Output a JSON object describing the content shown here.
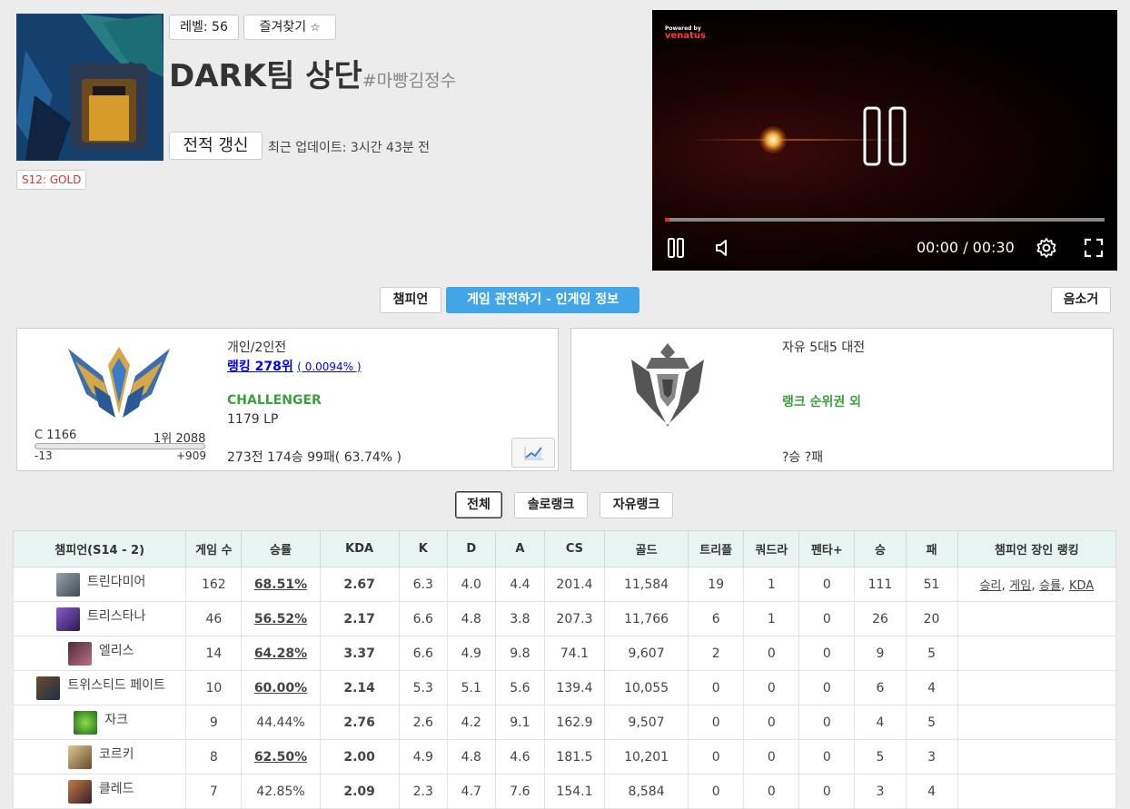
{
  "profile": {
    "level_label": "레벨: 56",
    "favorite_label": "즐겨찾기",
    "favorite_star": "☆",
    "name": "DARK팀 상단",
    "tag": "#마빵김정수",
    "refresh_label": "전적 갱신",
    "last_update": "최근 업데이트: 3시간 43분 전",
    "season_badge": "S12: GOLD"
  },
  "video": {
    "ad_powered": "Powered by",
    "ad_brand": "venatus",
    "time": "00:00 / 00:30",
    "progress": 0.01
  },
  "tabs": {
    "champion": "챔피언",
    "spectate": "게임 관전하기 - 인게임 정보",
    "remove": "음소거"
  },
  "solo_rank": {
    "queue": "개인/2인전",
    "ranking": "랭킹 278위",
    "ranking_pct": "( 0.0094% )",
    "tier": "CHALLENGER",
    "lp": "1179 LP",
    "cutoff_left": "C 1166",
    "cutoff_right": "1위 2088",
    "diff_left": "-13",
    "diff_right": "+909",
    "lp_progress": 0.01,
    "record": "273전 174승 99패( 63.74% )"
  },
  "flex_rank": {
    "queue": "자유 5대5 대전",
    "status": "랭크 순위권 외",
    "record": "?승 ?패"
  },
  "filters": {
    "all": "전체",
    "solo": "솔로랭크",
    "flex": "자유랭크"
  },
  "table": {
    "headers": [
      "챔피언(S14 - 2)",
      "게임 수",
      "승률",
      "KDA",
      "K",
      "D",
      "A",
      "CS",
      "골드",
      "트리플",
      "쿼드라",
      "펜타+",
      "승",
      "패",
      "챔피언 장인 랭킹"
    ],
    "mastery_links": [
      "승리",
      "게임",
      "승률",
      "KDA"
    ],
    "rows": [
      {
        "champion": "트린다미어",
        "games": "162",
        "winrate": "68.51%",
        "kda": "2.67",
        "k": "6.3",
        "d": "4.0",
        "a": "4.4",
        "cs": "201.4",
        "gold": "11,584",
        "triple": "19",
        "quadra": "1",
        "penta": "0",
        "wins": "111",
        "losses": "51"
      },
      {
        "champion": "트리스타나",
        "games": "46",
        "winrate": "56.52%",
        "kda": "2.17",
        "k": "6.6",
        "d": "4.8",
        "a": "3.8",
        "cs": "207.3",
        "gold": "11,766",
        "triple": "6",
        "quadra": "1",
        "penta": "0",
        "wins": "26",
        "losses": "20"
      },
      {
        "champion": "엘리스",
        "games": "14",
        "winrate": "64.28%",
        "kda": "3.37",
        "k": "6.6",
        "d": "4.9",
        "a": "9.8",
        "cs": "74.1",
        "gold": "9,607",
        "triple": "2",
        "quadra": "0",
        "penta": "0",
        "wins": "9",
        "losses": "5"
      },
      {
        "champion": "트위스티드 페이트",
        "games": "10",
        "winrate": "60.00%",
        "kda": "2.14",
        "k": "5.3",
        "d": "5.1",
        "a": "5.6",
        "cs": "139.4",
        "gold": "10,055",
        "triple": "0",
        "quadra": "0",
        "penta": "0",
        "wins": "6",
        "losses": "4"
      },
      {
        "champion": "자크",
        "games": "9",
        "winrate": "44.44%",
        "kda": "2.76",
        "k": "2.6",
        "d": "4.2",
        "a": "9.1",
        "cs": "162.9",
        "gold": "9,507",
        "triple": "0",
        "quadra": "0",
        "penta": "0",
        "wins": "4",
        "losses": "5"
      },
      {
        "champion": "코르키",
        "games": "8",
        "winrate": "62.50%",
        "kda": "2.00",
        "k": "4.9",
        "d": "4.8",
        "a": "4.6",
        "cs": "181.5",
        "gold": "10,201",
        "triple": "0",
        "quadra": "0",
        "penta": "0",
        "wins": "5",
        "losses": "3"
      },
      {
        "champion": "클레드",
        "games": "7",
        "winrate": "42.85%",
        "kda": "2.09",
        "k": "2.3",
        "d": "4.7",
        "a": "7.6",
        "cs": "154.1",
        "gold": "8,584",
        "triple": "0",
        "quadra": "0",
        "penta": "0",
        "wins": "3",
        "losses": "4"
      }
    ]
  },
  "colors": {
    "accent": "#42a5e8",
    "win_high": "#c0392b",
    "kda_green": "#3d9f3d",
    "kda_blue": "#2f3fbf",
    "header_bg": "#e8f4f1"
  }
}
